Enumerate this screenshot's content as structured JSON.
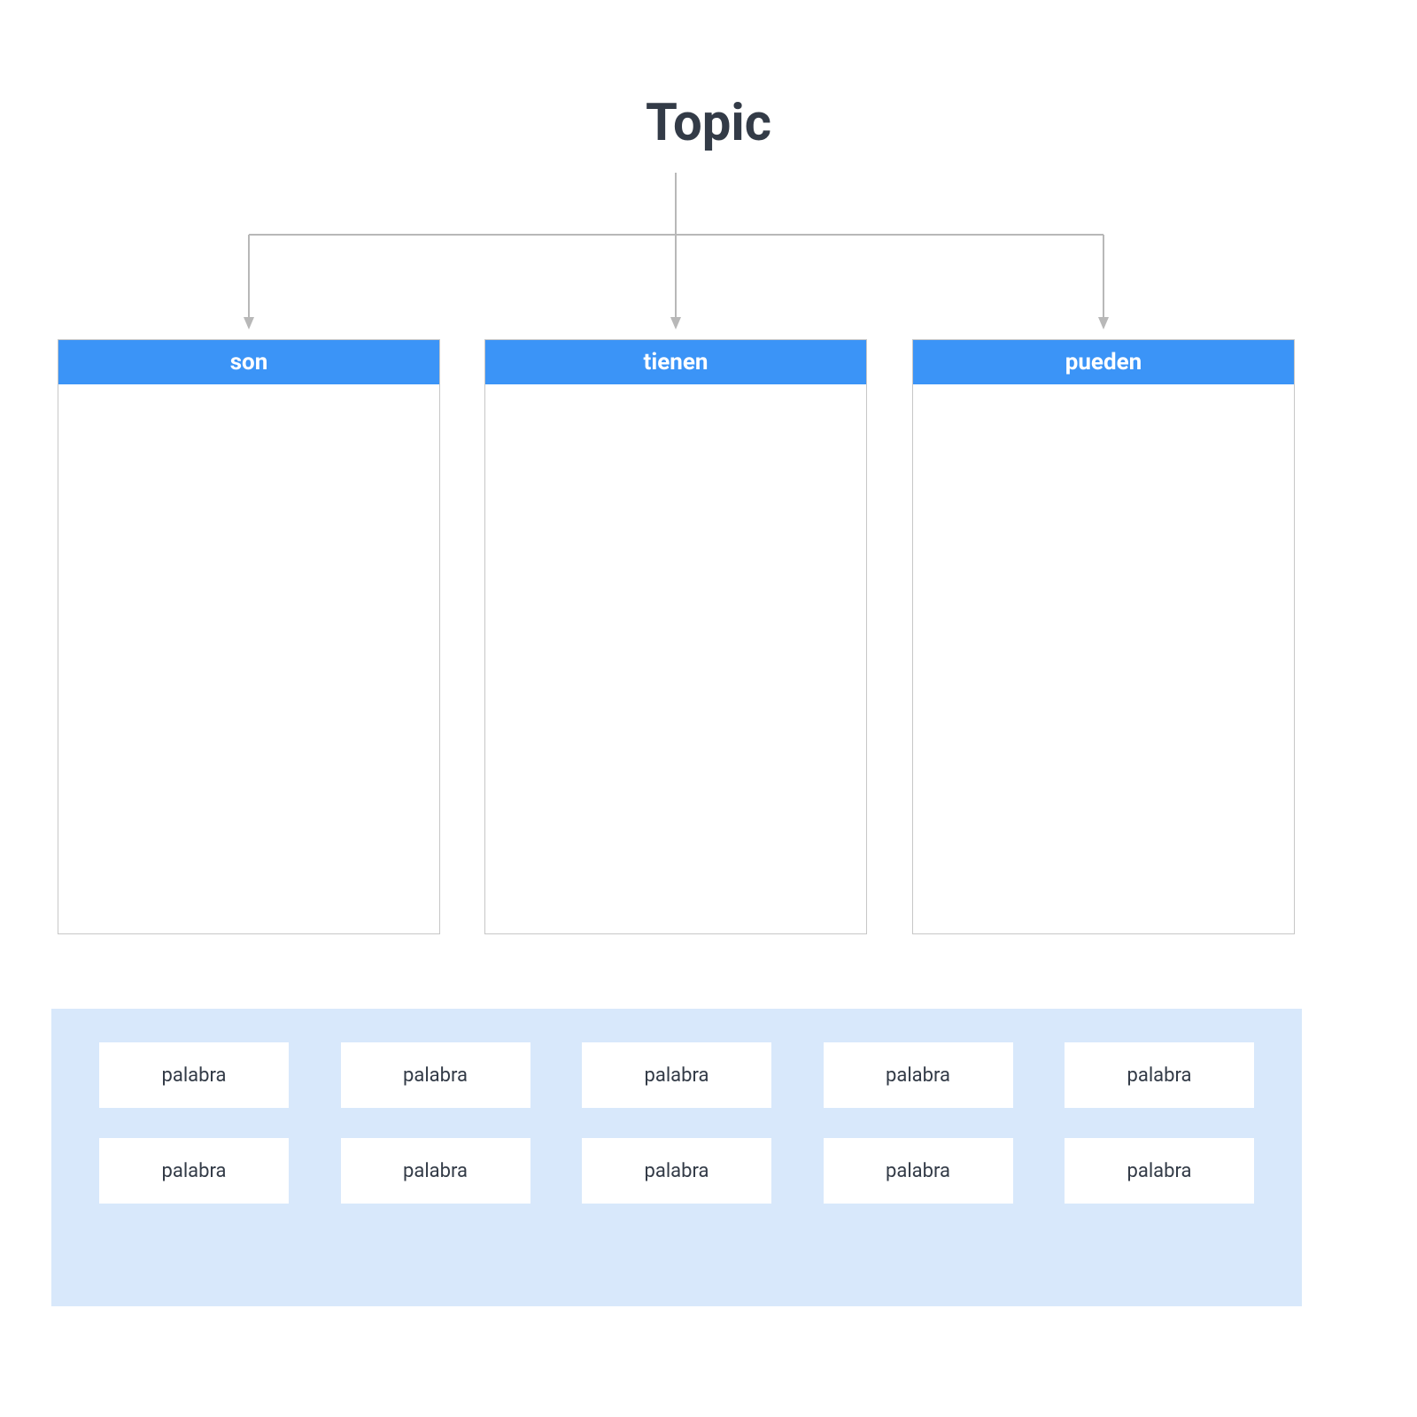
{
  "title": "Topic",
  "columns": [
    {
      "header": "son"
    },
    {
      "header": "tienen"
    },
    {
      "header": "pueden"
    }
  ],
  "words": {
    "row1": [
      "palabra",
      "palabra",
      "palabra",
      "palabra",
      "palabra"
    ],
    "row2": [
      "palabra",
      "palabra",
      "palabra",
      "palabra",
      "palabra"
    ]
  },
  "colors": {
    "header_bg": "#3b94f7",
    "bank_bg": "#d8e8fb",
    "text": "#333b47",
    "border": "#c7c7c7"
  }
}
